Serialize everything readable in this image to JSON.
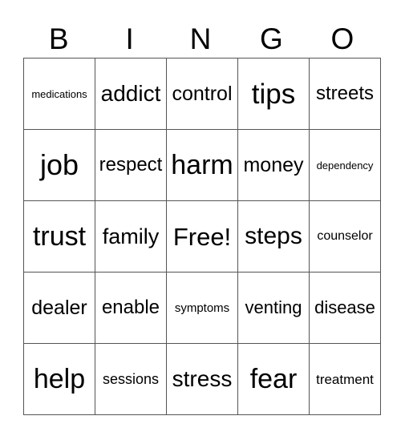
{
  "header": [
    "B",
    "I",
    "N",
    "G",
    "O"
  ],
  "rows": [
    [
      {
        "t": "medications",
        "s": 13
      },
      {
        "t": "addict",
        "s": 28
      },
      {
        "t": "control",
        "s": 25
      },
      {
        "t": "tips",
        "s": 35
      },
      {
        "t": "streets",
        "s": 24
      }
    ],
    [
      {
        "t": "job",
        "s": 36
      },
      {
        "t": "respect",
        "s": 24
      },
      {
        "t": "harm",
        "s": 34
      },
      {
        "t": "money",
        "s": 25
      },
      {
        "t": "dependency",
        "s": 13
      }
    ],
    [
      {
        "t": "trust",
        "s": 34
      },
      {
        "t": "family",
        "s": 27
      },
      {
        "t": "Free!",
        "s": 31
      },
      {
        "t": "steps",
        "s": 30
      },
      {
        "t": "counselor",
        "s": 16
      }
    ],
    [
      {
        "t": "dealer",
        "s": 25
      },
      {
        "t": "enable",
        "s": 24
      },
      {
        "t": "symptoms",
        "s": 15
      },
      {
        "t": "venting",
        "s": 22
      },
      {
        "t": "disease",
        "s": 22
      }
    ],
    [
      {
        "t": "help",
        "s": 34
      },
      {
        "t": "sessions",
        "s": 18
      },
      {
        "t": "stress",
        "s": 28
      },
      {
        "t": "fear",
        "s": 34
      },
      {
        "t": "treatment",
        "s": 17
      }
    ]
  ]
}
